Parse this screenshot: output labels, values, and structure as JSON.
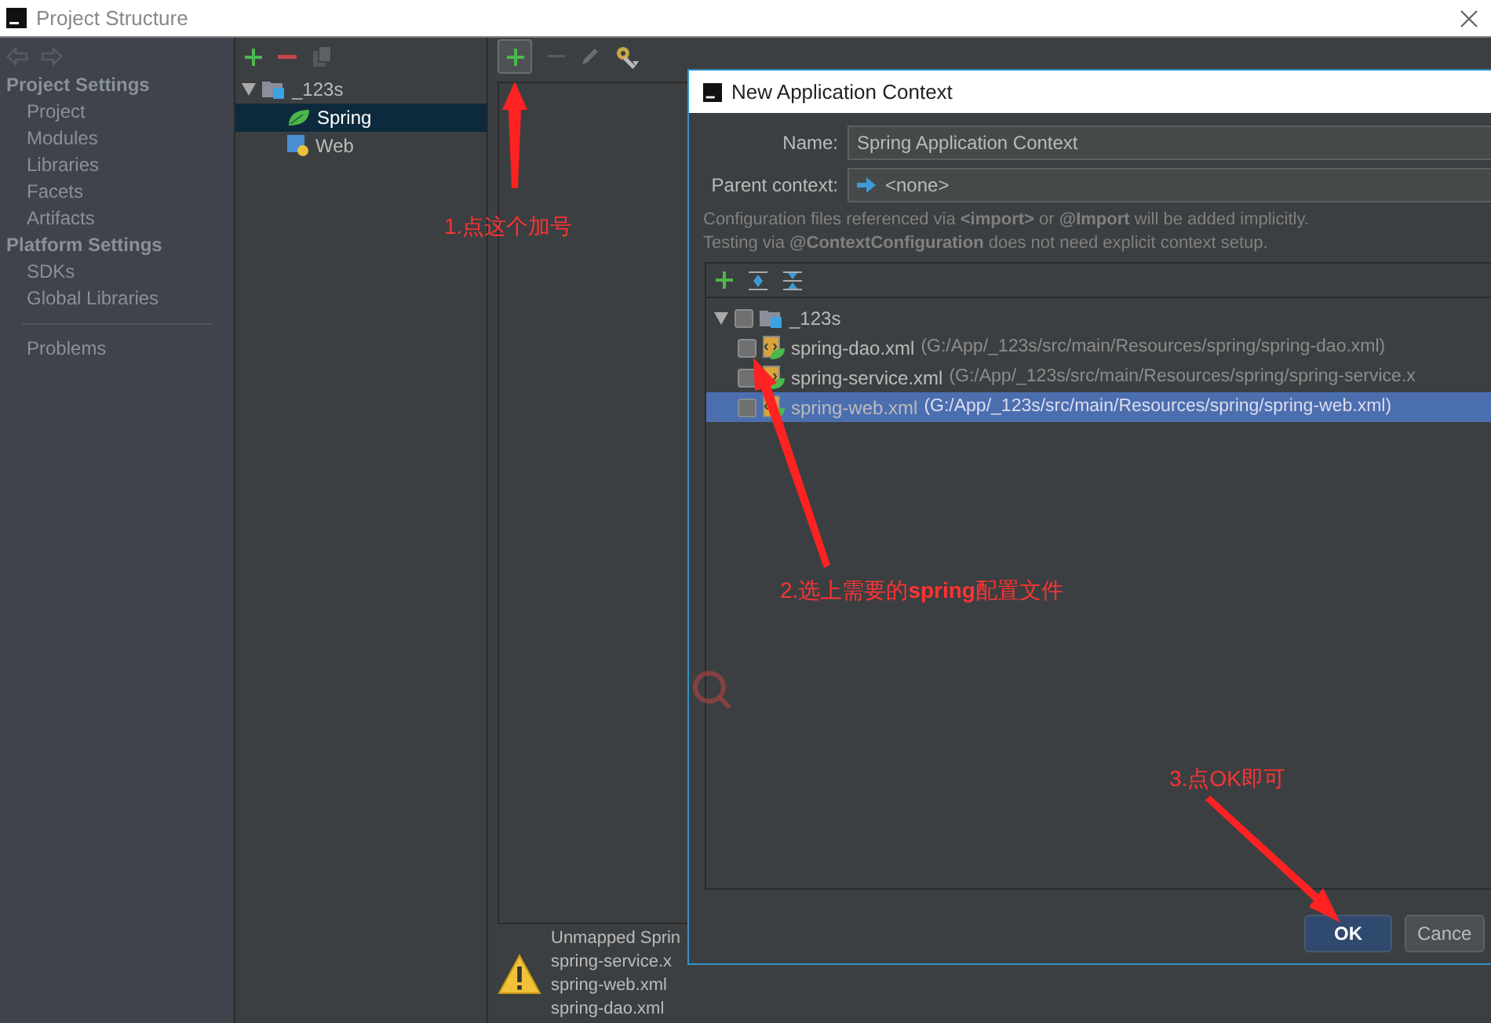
{
  "window": {
    "title": "Project Structure"
  },
  "sidebar": {
    "sections": [
      {
        "title": "Project Settings",
        "items": [
          {
            "label": "Project",
            "selected": false
          },
          {
            "label": "Modules",
            "selected": false
          },
          {
            "label": "Libraries",
            "selected": false
          },
          {
            "label": "Facets",
            "selected": false
          },
          {
            "label": "Artifacts",
            "selected": false
          }
        ]
      },
      {
        "title": "Platform Settings",
        "items": [
          {
            "label": "SDKs",
            "selected": false
          },
          {
            "label": "Global Libraries",
            "selected": false
          }
        ]
      },
      {
        "items": [
          {
            "label": "Problems",
            "selected": false
          }
        ]
      }
    ]
  },
  "facet_tree": [
    {
      "label": "_123s",
      "kind": "module",
      "expanded": true,
      "selected": false,
      "children": [
        {
          "label": "Spring",
          "kind": "spring",
          "selected": true
        },
        {
          "label": "Web",
          "kind": "web",
          "selected": false
        }
      ]
    }
  ],
  "warning": {
    "lines": [
      "Unmapped Sprin",
      "spring-service.x",
      "spring-web.xml",
      "spring-dao.xml"
    ]
  },
  "dialog": {
    "title": "New Application Context",
    "name_label": "Name:",
    "name_value": "Spring Application Context",
    "parent_label": "Parent context:",
    "parent_value": "<none>",
    "info": [
      "Configuration files referenced via **<import>** or **@Import** will be added implicitly.",
      "Testing via **@ContextConfiguration** does not need explicit context setup."
    ],
    "files": [
      {
        "label": "_123s",
        "kind": "module",
        "expanded": true,
        "checked": false,
        "selected": false,
        "children": [
          {
            "label": "spring-dao.xml",
            "path": "(G:/App/_123s/src/main/Resources/spring/spring-dao.xml)",
            "kind": "xml",
            "checked": false,
            "selected": false
          },
          {
            "label": "spring-service.xml",
            "path": "(G:/App/_123s/src/main/Resources/spring/spring-service.x",
            "kind": "xml",
            "checked": false,
            "selected": false
          },
          {
            "label": "spring-web.xml",
            "path": "(G:/App/_123s/src/main/Resources/spring/spring-web.xml)",
            "kind": "xml",
            "checked": false,
            "selected": true
          }
        ]
      }
    ],
    "buttons": [
      {
        "label": "OK",
        "kind": "primary"
      },
      {
        "label": "Cance",
        "kind": "secondary"
      }
    ]
  },
  "annotations": [
    "1.点这个加号",
    "2.选上需要的**spring**配置文件",
    "3.点OK即可"
  ]
}
